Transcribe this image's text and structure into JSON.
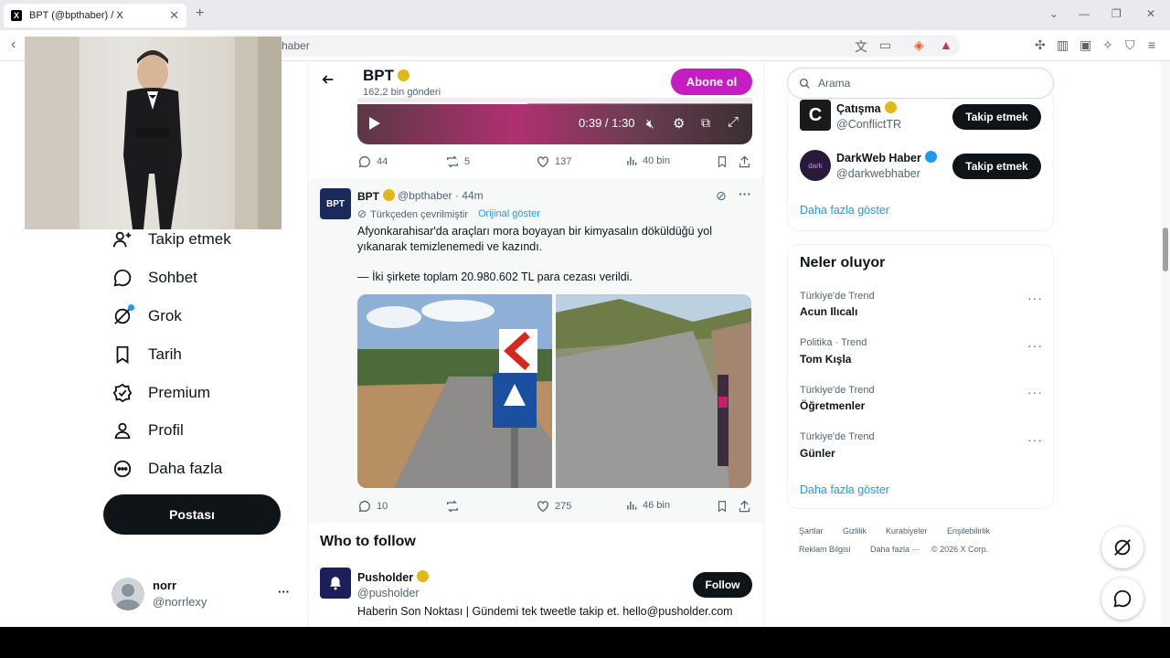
{
  "browser": {
    "tab_title": "BPT (@bpthaber) / X",
    "tab_close": "✕",
    "new_tab": "+",
    "url_fragment": "haber"
  },
  "nav": {
    "items": [
      {
        "label": "Takip etmek"
      },
      {
        "label": "Sohbet"
      },
      {
        "label": "Grok"
      },
      {
        "label": "Tarih"
      },
      {
        "label": "Premium"
      },
      {
        "label": "Profil"
      },
      {
        "label": "Daha fazla"
      }
    ],
    "post_button": "Postası",
    "account": {
      "name": "norr",
      "handle": "@norrlexy",
      "more": "···"
    }
  },
  "profile_header": {
    "name": "BPT",
    "post_count": "162,2 bin gönderi",
    "subscribe_button": "Abone ol"
  },
  "video": {
    "time": "0:39 / 1:30",
    "progress": 0.43
  },
  "tweet1": {
    "replies": "44",
    "retweets": "5",
    "likes": "137",
    "views": "40 bin"
  },
  "tweet2": {
    "name": "BPT",
    "handle_time": "@bpthaber · 44m",
    "translated_note": "Türkçeden çevrilmiştir",
    "show_original": "Orijinal göster",
    "text_line1": "Afyonkarahisar'da araçları mora boyayan bir kimyasalın döküldüğü yol",
    "text_line2": "yıkanarak temizlenemedi ve kazındı.",
    "text_line3": "— İki şirkete toplam 20.980.602 TL para cezası verildi.",
    "replies": "10",
    "retweets": "",
    "likes": "275",
    "views": "46 bin",
    "avatar_text": "BPT"
  },
  "who_to_follow": {
    "title": "Who to follow",
    "account": {
      "name": "Pusholder",
      "handle": "@pusholder",
      "bio": "Haberin Son Noktası | Gündemi tek tweetle takip et. hello@pusholder.com",
      "follow_button": "Follow"
    }
  },
  "right": {
    "search_placeholder": "Arama",
    "suggestions": [
      {
        "name": "Çatışma",
        "handle": "@ConflictTR",
        "button": "Takip etmek",
        "badge": "gold"
      },
      {
        "name": "DarkWeb Haber",
        "handle": "@darkwebhaber",
        "button": "Takip etmek",
        "badge": "blue"
      }
    ],
    "show_more_1": "Daha fazla göster",
    "trends_title": "Neler oluyor",
    "trends": [
      {
        "meta": "Türkiye'de Trend",
        "name": "Acun Ilıcalı"
      },
      {
        "meta": "Politika · Trend",
        "name": "Tom Kışla"
      },
      {
        "meta": "Türkiye'de Trend",
        "name": "Öğretmenler"
      },
      {
        "meta": "Türkiye'de Trend",
        "name": "Günler"
      }
    ],
    "show_more_2": "Daha fazla göster",
    "footer": {
      "terms": "Şartlar",
      "privacy": "Gizlilik",
      "cookies": "Kurabiyeler",
      "accessibility": "Erişilebilirlik",
      "ads": "Reklam Bilgisi",
      "more": "Daha fazla ···",
      "copyright": "© 2026 X Corp."
    }
  }
}
